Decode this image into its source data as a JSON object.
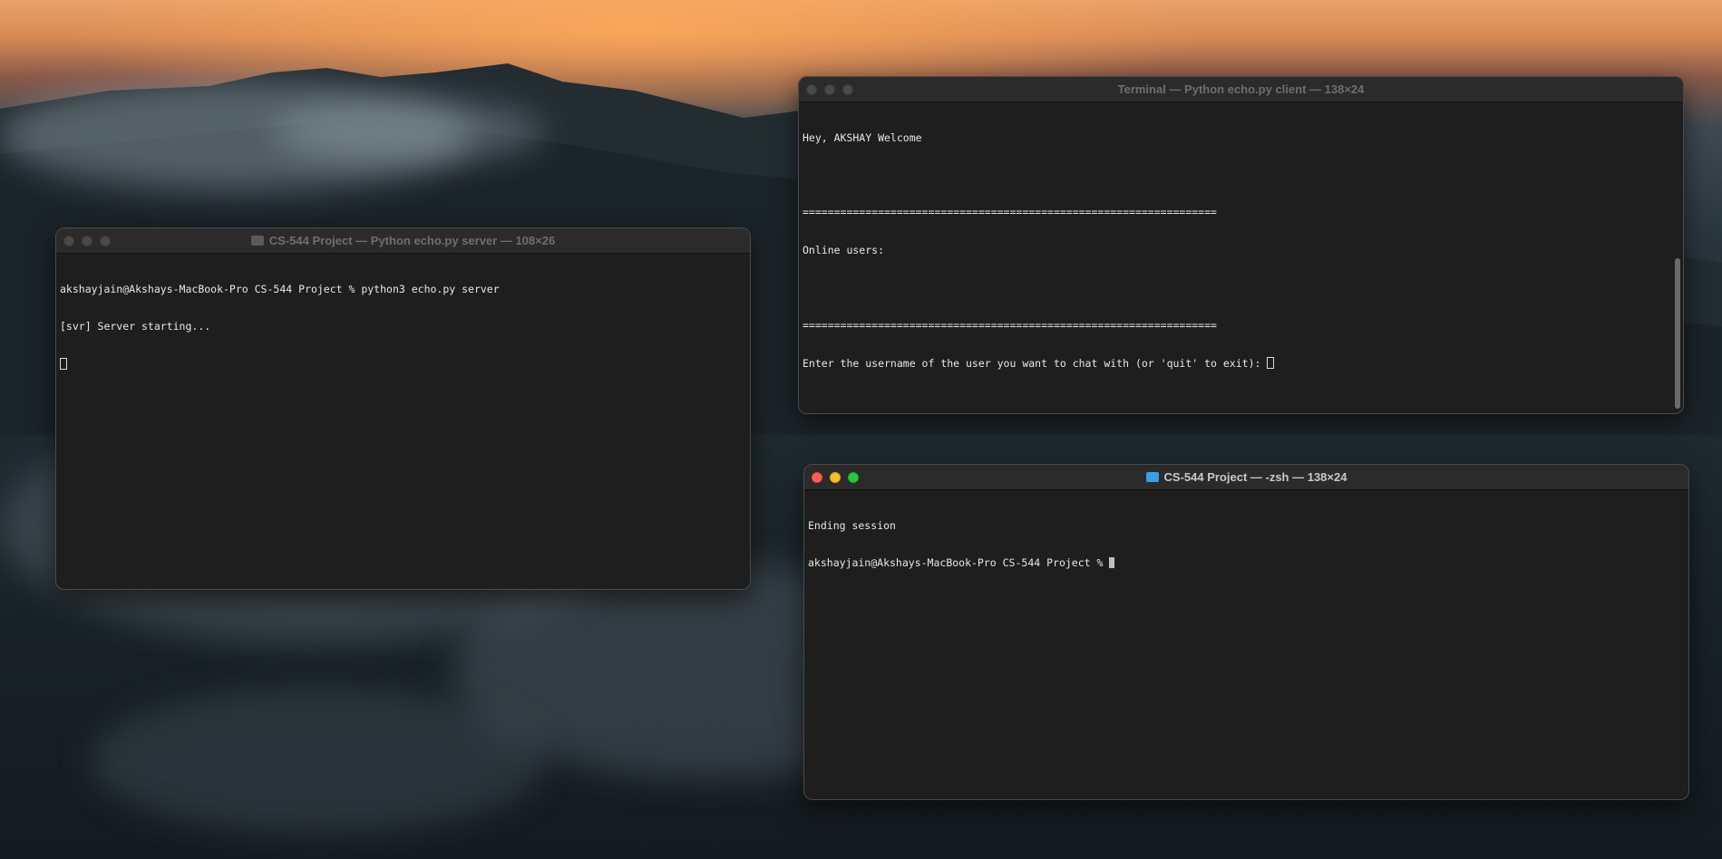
{
  "windows": {
    "server": {
      "title": "CS-544 Project — Python echo.py server — 108×26",
      "lines": [
        "akshayjain@Akshays-MacBook-Pro CS-544 Project % python3 echo.py server",
        "[svr] Server starting..."
      ]
    },
    "client": {
      "title": "Terminal — Python echo.py client — 138×24",
      "lines": [
        "Hey, AKSHAY Welcome",
        "",
        "==================================================================",
        "Online users:",
        "",
        "==================================================================",
        "Enter the username of the user you want to chat with (or 'quit' to exit): "
      ]
    },
    "zsh": {
      "title": "CS-544 Project — -zsh — 138×24",
      "lines": [
        "Ending session",
        "akshayjain@Akshays-MacBook-Pro CS-544 Project % "
      ]
    }
  },
  "icons": {
    "folder": "folder-icon",
    "close": "close-icon",
    "minimize": "minimize-icon",
    "maximize": "maximize-icon"
  },
  "colors": {
    "close": "#ff5f57",
    "minimize": "#febc2e",
    "maximize": "#28c840",
    "terminal_bg": "#1e1e1e"
  }
}
